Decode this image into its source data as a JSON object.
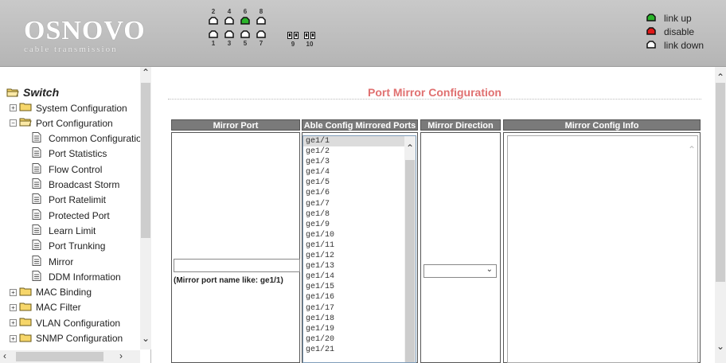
{
  "header": {
    "logo_name": "OSNOVO",
    "logo_sub": "cable transmission",
    "ports_top": [
      "2",
      "4",
      "6",
      "8"
    ],
    "ports_bottom": [
      "1",
      "3",
      "5",
      "7"
    ],
    "ports_sfp": [
      "9",
      "10"
    ],
    "port_status": {
      "port6": "link up"
    },
    "legend": [
      {
        "label": "link up",
        "color": "#2bb52b"
      },
      {
        "label": "disable",
        "color": "#e01818"
      },
      {
        "label": "link down",
        "color": "#ffffff"
      }
    ]
  },
  "sidebar": {
    "root": "Switch",
    "items": [
      {
        "label": "System Configuration",
        "type": "folder",
        "expanded": false
      },
      {
        "label": "Port Configuration",
        "type": "folder",
        "expanded": true
      },
      {
        "label": "Common Configuratio",
        "type": "doc"
      },
      {
        "label": "Port Statistics",
        "type": "doc"
      },
      {
        "label": "Flow Control",
        "type": "doc"
      },
      {
        "label": "Broadcast Storm",
        "type": "doc"
      },
      {
        "label": "Port Ratelimit",
        "type": "doc"
      },
      {
        "label": "Protected Port",
        "type": "doc"
      },
      {
        "label": "Learn Limit",
        "type": "doc"
      },
      {
        "label": "Port Trunking",
        "type": "doc"
      },
      {
        "label": "Mirror",
        "type": "doc"
      },
      {
        "label": "DDM Information",
        "type": "doc"
      },
      {
        "label": "MAC Binding",
        "type": "folder",
        "expanded": false
      },
      {
        "label": "MAC Filter",
        "type": "folder",
        "expanded": false
      },
      {
        "label": "VLAN Configuration",
        "type": "folder",
        "expanded": false
      },
      {
        "label": "SNMP Configuration",
        "type": "folder",
        "expanded": false
      }
    ]
  },
  "main": {
    "title": "Port Mirror Configuration",
    "columns": [
      "Mirror Port",
      "Able Config Mirrored Ports",
      "Mirror Direction",
      "Mirror Config Info"
    ],
    "mirror_port_value": "",
    "mirror_port_hint": "(Mirror port name like: ge1/1)",
    "ports": [
      "ge1/1",
      "ge1/2",
      "ge1/3",
      "ge1/4",
      "ge1/5",
      "ge1/6",
      "ge1/7",
      "ge1/8",
      "ge1/9",
      "ge1/10",
      "ge1/11",
      "ge1/12",
      "ge1/13",
      "ge1/14",
      "ge1/15",
      "ge1/16",
      "ge1/17",
      "ge1/18",
      "ge1/19",
      "ge1/20",
      "ge1/21"
    ],
    "selected_port": "ge1/1",
    "mirror_direction": "",
    "mirror_config_info": ""
  }
}
